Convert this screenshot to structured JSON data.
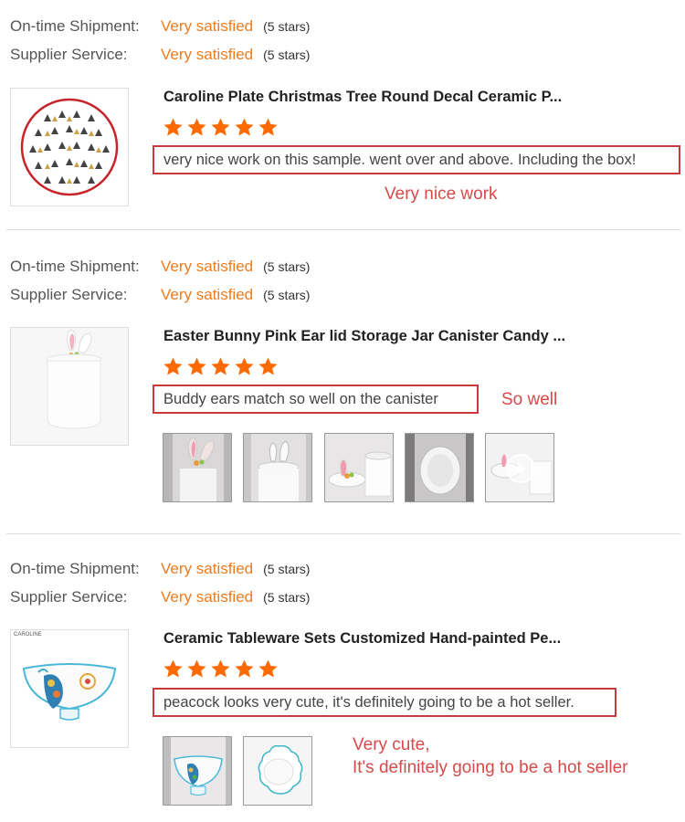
{
  "labels": {
    "shipment": "On-time Shipment:",
    "service": "Supplier Service:"
  },
  "rating_value": "Very satisfied",
  "rating_stars_text": "(5 stars)",
  "reviews": [
    {
      "title": "Caroline Plate Christmas Tree Round Decal Ceramic P...",
      "stars": 5,
      "comment": "very nice work on this sample. went over and above. Including the box!",
      "note": "Very nice work",
      "photos": 0
    },
    {
      "title": "Easter Bunny Pink Ear lid Storage Jar Canister Candy ...",
      "stars": 5,
      "comment": "Buddy ears match so well on the canister",
      "note": "So well",
      "photos": 5
    },
    {
      "title": "Ceramic Tableware Sets Customized Hand-painted Pe...",
      "stars": 5,
      "comment": "peacock looks very cute, it's definitely going to be a hot seller.",
      "note_line1": "Very cute,",
      "note_line2": "It's definitely going to be a hot seller",
      "brand_mark": "CAROLINE",
      "photos": 2
    }
  ],
  "colors": {
    "accent": "#f07b1d",
    "star": "#ff6a00",
    "highlight_border": "#c8393f",
    "annotation": "#d84a4a"
  },
  "icons": [
    "star-icon",
    "play-icon"
  ]
}
